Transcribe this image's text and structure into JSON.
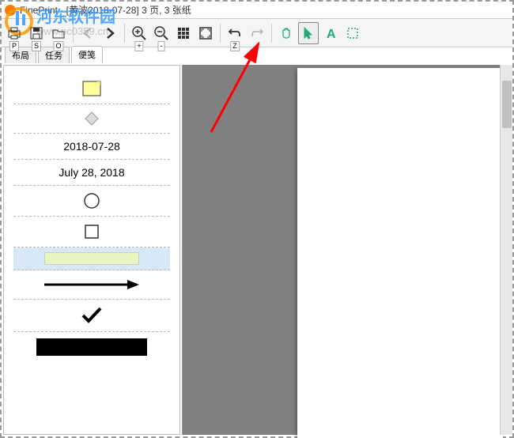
{
  "window": {
    "title": "FinePrint - [黄波2018-07-28] 3 页, 3 张纸"
  },
  "toolbar": {
    "print_key": "P",
    "save_key": "S",
    "open_key": "O",
    "zoomin_key": "+",
    "zoomout_key": "-",
    "undo_key": "Z"
  },
  "tabs": {
    "layout": "布局",
    "tasks": "任务",
    "notes": "便笺"
  },
  "sidebar": {
    "date_iso": "2018-07-28",
    "date_long": "July 28, 2018"
  },
  "watermark": {
    "text": "河东软件园",
    "url": "www.pc0359.cn"
  }
}
